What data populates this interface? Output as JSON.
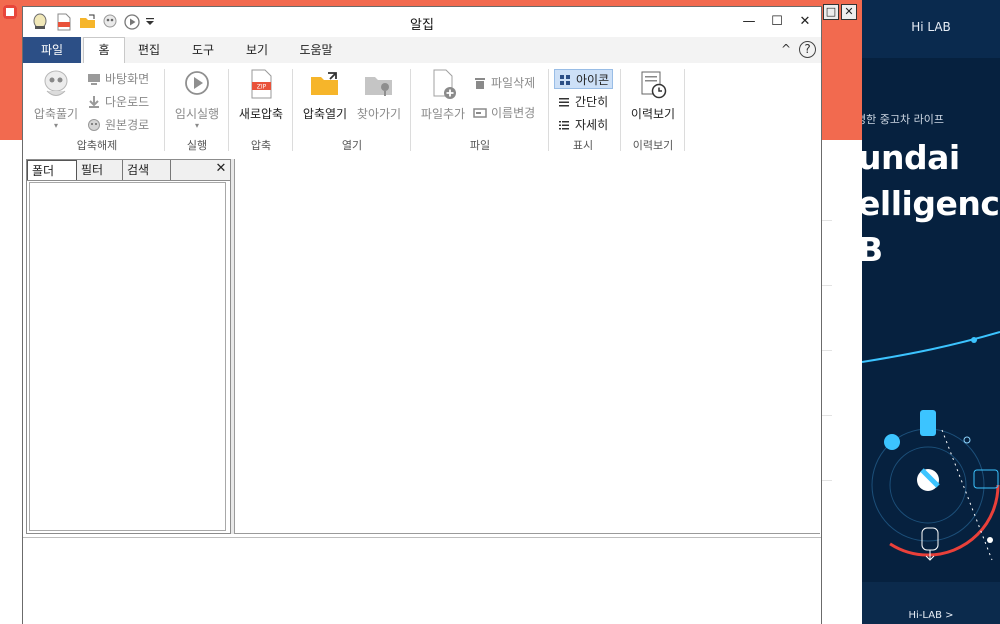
{
  "window": {
    "title": "알집",
    "controls": {
      "minimize": "—",
      "maximize": "☐",
      "close": "✕"
    }
  },
  "quick_access": {
    "icons": [
      "alzip-logo-icon",
      "zip-file-icon",
      "folder-open-icon",
      "extract-icon",
      "play-icon",
      "dropdown-arrow-icon"
    ]
  },
  "menu": {
    "file": "파일",
    "tabs": [
      "홈",
      "편집",
      "도구",
      "보기",
      "도움말"
    ],
    "active_tab": "홈",
    "collapse_icon": "^",
    "help_icon": "?"
  },
  "ribbon": {
    "groups": {
      "extract": "압축해제",
      "run": "실행",
      "compress": "압축",
      "open": "열기",
      "file": "파일",
      "view": "표시",
      "history": "이력보기"
    },
    "extract_btn": "압축풀기",
    "desktop_btn": "바탕화면",
    "download_btn": "다운로드",
    "original_path_btn": "원본경로",
    "temp_run_btn": "임시실행",
    "new_zip_btn": "새로압축",
    "open_zip_btn": "압축열기",
    "browse_btn": "찾아가기",
    "add_file_btn": "파일추가",
    "delete_file_btn": "파일삭제",
    "rename_btn": "이름변경",
    "view_icon_btn": "아이콘",
    "view_simple_btn": "간단히",
    "view_detail_btn": "자세히",
    "history_btn": "이력보기"
  },
  "left_panel": {
    "tabs": [
      "폴더",
      "필터",
      "검색"
    ],
    "active_tab": "폴더",
    "close": "✕"
  },
  "background": {
    "ad_title": "Hi LAB",
    "ad_sub": "명한 중고차 라이프",
    "ad_lines": [
      "undai",
      "elligence",
      "B"
    ],
    "ad_cta": "Hi-LAB >",
    "outer_controls": {
      "maximize": "□",
      "close": "✕"
    }
  },
  "colors": {
    "file_tab": "#2c4f86",
    "background_orange": "#f26a4f",
    "ad_navy": "#06213f",
    "ad_accent_red": "#e9403a",
    "ad_accent_cyan": "#3cc4ff",
    "selected_view": "#cde0f7"
  }
}
